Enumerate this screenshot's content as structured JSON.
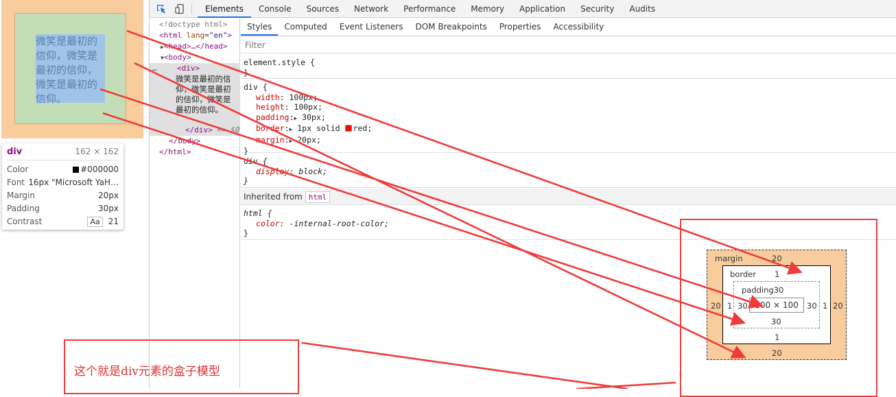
{
  "page": {
    "text": "微笑是最初的信仰，微笑是最初的信仰，微笑是最初的信仰。"
  },
  "tooltip": {
    "tag": "div",
    "size": "162 × 162",
    "color_label": "Color",
    "color_value": "#000000",
    "font_label": "Font",
    "font_value": "16px \"Microsoft YaH…",
    "margin_label": "Margin",
    "margin_value": "20px",
    "padding_label": "Padding",
    "padding_value": "30px",
    "contrast_label": "Contrast",
    "contrast_badge": "Aa",
    "contrast_value": "21"
  },
  "toolbar": {
    "inspect_icon": "inspect-icon",
    "device_icon": "device-toggle-icon",
    "tabs": [
      "Elements",
      "Console",
      "Sources",
      "Network",
      "Performance",
      "Memory",
      "Application",
      "Security",
      "Audits"
    ],
    "active_tab": "Elements"
  },
  "elements": {
    "doctype": "<!doctype html>",
    "html_open_tag": "<html",
    "html_attr": "lang",
    "html_attr_val": "\"en\"",
    "html_open_end": ">",
    "head": "<head>…</head>",
    "body_open": "<body>",
    "ellipsis": "…",
    "div_open": "<div>",
    "div_text": "微笑是最初的信仰，微笑是最初的信仰，微笑是最初的信仰。",
    "div_close": "</div>",
    "div_marker": "== $0",
    "body_close": "</body>",
    "html_close": "</html>"
  },
  "styles": {
    "sub_tabs": [
      "Styles",
      "Computed",
      "Event Listeners",
      "DOM Breakpoints",
      "Properties",
      "Accessibility"
    ],
    "active_sub_tab": "Styles",
    "filter_placeholder": "Filter",
    "element_style_selector": "element.style {",
    "close_brace": "}",
    "div_selector": "div {",
    "div_props": [
      {
        "name": "width",
        "value": "100px;"
      },
      {
        "name": "height",
        "value": "100px;"
      },
      {
        "name": "padding",
        "value": "30px;"
      },
      {
        "name": "border",
        "value": "1px solid",
        "value_after": "red;"
      },
      {
        "name": "margin",
        "value": "20px;"
      }
    ],
    "ua_selector": "div {",
    "ua_prop_name": "display",
    "ua_prop_value": "block;",
    "inherited_label": "Inherited from",
    "inherited_badge": "html",
    "html_selector": "html {",
    "html_prop_name": "color",
    "html_prop_value": "-internal-root-color;"
  },
  "box_model": {
    "margin_label": "margin",
    "margin_top": "20",
    "margin_bottom": "20",
    "margin_left": "20",
    "margin_right": "20",
    "border_label": "border",
    "border_top": "1",
    "border_bottom": "1",
    "border_left": "1",
    "border_right": "1",
    "padding_label": "padding30",
    "padding_bottom": "30",
    "padding_left": "30",
    "padding_right": "30",
    "content": "100 × 100"
  },
  "annotation": {
    "text": "这个就是div元素的盒子模型"
  },
  "colors": {
    "margin": "#f9cc9d",
    "border_box": "#c3deb7",
    "content": "#9fc4e7",
    "annotation_red": "#ef3b3b",
    "accent": "#1a73e8"
  }
}
